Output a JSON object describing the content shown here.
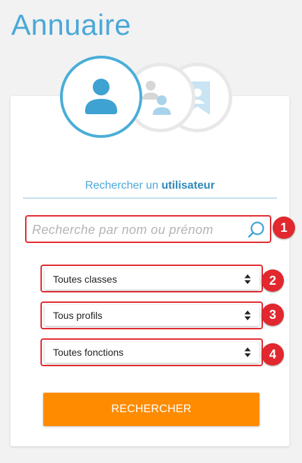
{
  "page": {
    "title": "Annuaire"
  },
  "search": {
    "label_prefix": "Rechercher un",
    "label_bold": "utilisateur",
    "placeholder": "Recherche par nom ou prénom"
  },
  "filters": {
    "classes": "Toutes classes",
    "profils": "Tous profils",
    "fonctions": "Toutes fonctions"
  },
  "badges": [
    "1",
    "2",
    "3",
    "4"
  ],
  "button": {
    "label": "RECHERCHER"
  },
  "colors": {
    "accent": "#4aa8d8",
    "button": "#ff8c00",
    "highlight": "#e0282e"
  }
}
